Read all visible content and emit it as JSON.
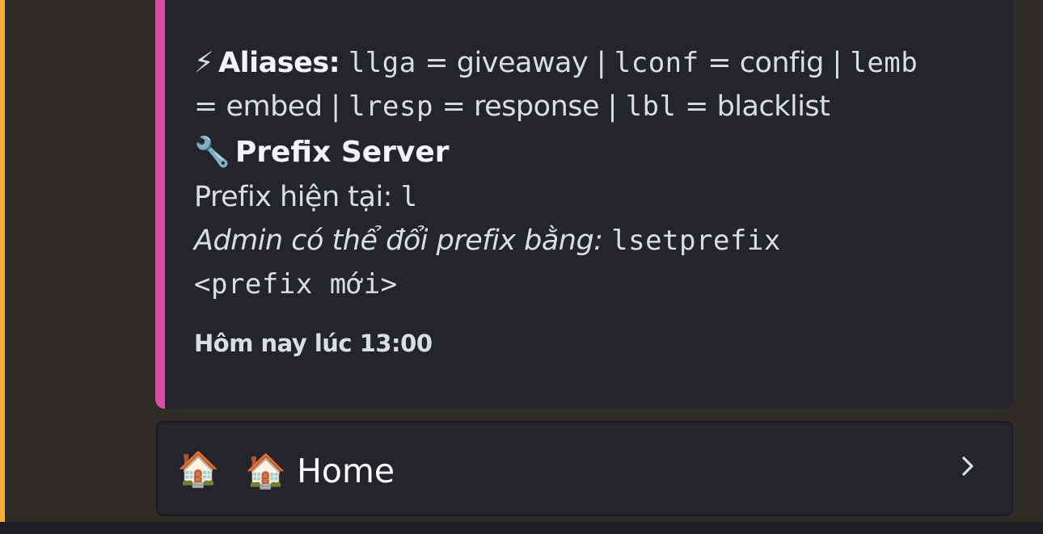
{
  "embed": {
    "aliases": {
      "emoji": "⚡",
      "label": "Aliases:",
      "items": [
        {
          "cmd": "llga",
          "name": "giveaway"
        },
        {
          "cmd": "lconf",
          "name": "config"
        },
        {
          "cmd": "lemb",
          "name": "embed"
        },
        {
          "cmd": "lresp",
          "name": "response"
        },
        {
          "cmd": "lbl",
          "name": "blacklist"
        }
      ]
    },
    "prefix_section": {
      "emoji": "🔧",
      "title": "Prefix Server",
      "current_label": "Prefix hiện tại:",
      "current_value": "l",
      "admin_text": "Admin có thể đổi prefix bằng:",
      "command_part1": "lsetprefix",
      "command_part2": "<prefix mới>"
    },
    "timestamp": "Hôm nay lúc 13:00",
    "colors": {
      "accent": "#d64fa0",
      "background": "#24252b"
    }
  },
  "select_menu": {
    "icon": "🏠",
    "label": "🏠 Home",
    "chevron": "chevron-right-icon"
  },
  "mention_highlight_color": "#f0b232"
}
